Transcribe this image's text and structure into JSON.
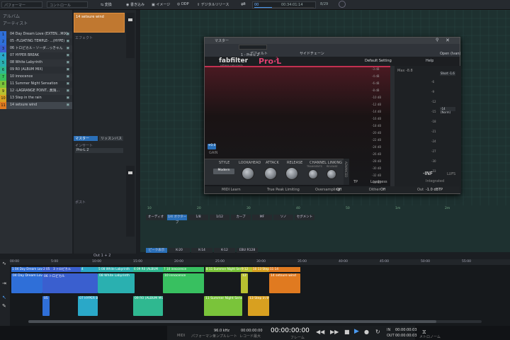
{
  "topbar": {
    "field1": "パフォーマー",
    "field2": "コントロール",
    "btn_change": "変換",
    "btn_write": "書き込み",
    "btn_image": "イメージ",
    "btn_ddp": "DDP",
    "btn_digital": "デジタルリリース",
    "time_start": "00",
    "time_current": "00:34:01:14",
    "time_end": "8/29"
  },
  "leftpanel": {
    "header_album": "アルバム",
    "header_artist": "アーティスト",
    "tracks": [
      {
        "num": "1",
        "label": "04 Day Dream Love (EXTEN...MIX)",
        "color": "#2f6fd8"
      },
      {
        "num": "2",
        "label": "05 -FLOATING TEMPLE- ...(HYPE)",
        "color": "#2f6fd8"
      },
      {
        "num": "3",
        "label": "06 トロピカル・ソーダ...っきゃん",
        "color": "#3a5fcf"
      },
      {
        "num": "4",
        "label": "07 HYPER BREAK",
        "color": "#2aa8c8"
      },
      {
        "num": "5",
        "label": "08 White Labyrinth",
        "color": "#2ab0b0"
      },
      {
        "num": "6",
        "label": "09 R0 (ALBUM MIX)",
        "color": "#2fb890"
      },
      {
        "num": "7",
        "label": "10 innocence",
        "color": "#38c060"
      },
      {
        "num": "8",
        "label": "11 Summer Night Sensation",
        "color": "#7ac43a"
      },
      {
        "num": "9",
        "label": "12 -LAGRANGE POINT...無限...",
        "color": "#b8c030"
      },
      {
        "num": "10",
        "label": "13 Step in the rain",
        "color": "#d8a020"
      },
      {
        "num": "11",
        "label": "14 setsure wind",
        "color": "#e07a20"
      }
    ]
  },
  "midpanel": {
    "track_selected": "14 setsure wind",
    "insert_label": "インサート",
    "fx_label": "エフェクト",
    "plugin_slot": "Pro-L 2",
    "tab_master": "マスター",
    "tab_sub": "リッスンバス",
    "post_label": "ポスト",
    "bottom_label": "Out 1 + 2"
  },
  "editor": {
    "ruler": [
      "10",
      "20",
      "30",
      "40",
      "50",
      "1m",
      "2m"
    ],
    "tabs": [
      "オーディオ",
      "1/4 オクターブ",
      "1/8",
      "1/12",
      "カーブ",
      "MF",
      "ソノ",
      "セグメント"
    ],
    "bottom_tabs": [
      "ピーク表示",
      "K-20",
      "K-14",
      "K-12",
      "EBU R128"
    ]
  },
  "plugin": {
    "title": "マスター",
    "slot": "1 - Pro-L 2",
    "preset": "デフォルト",
    "side": "サイドチェーン",
    "brand": "fabfilter",
    "brand_sub": "software instruments",
    "product": "Pro·L",
    "product_ver": "2",
    "preset_name": "Default Setting",
    "help": "Help",
    "open": "Open (Ivan)",
    "style_label": "STYLE",
    "style_value": "Modern",
    "lookahead_label": "LOOKAHEAD",
    "attack_label": "ATTACK",
    "release_label": "RELEASE",
    "channel_label": "CHANNEL LINKING",
    "transients": "TRANSIENTS",
    "release_sub": "RELEASE",
    "advanced": "ADVANCED",
    "gain_label": "GAIN",
    "gain_value": "+0.0",
    "midi_learn": "MIDI Learn",
    "true_peak": "True Peak Limiting",
    "oversampling_label": "Oversampling",
    "oversampling_value": "Off",
    "dither_label": "Dither",
    "dither_value": "Off",
    "out_label": "Out",
    "out_value": "-1.0 dBTP",
    "tp_label": "TP",
    "loudness_label": "Loudness",
    "inf": "-INF",
    "lufs": "LUFS",
    "integrated": "Integrated",
    "short_term": "Short -1.6",
    "lufs_val": "-14 (Norm)",
    "max_label": "Max -8.8",
    "db_scale": [
      "-3 dB",
      "-4 dB",
      "-6 dB",
      "-8 dB",
      "-10 dB",
      "-12 dB",
      "-14 dB",
      "-16 dB",
      "-18 dB",
      "-20 dB",
      "-22 dB",
      "-24 dB",
      "-26 dB",
      "-28 dB",
      "-30 dB",
      "-32 dB",
      "-34 dB"
    ],
    "lufs_scale": [
      "-6",
      "-9",
      "-12",
      "-15",
      "-18",
      "-21",
      "-24",
      "-27",
      "-30",
      "-33"
    ]
  },
  "arrange": {
    "ruler": [
      "00:00",
      "5:00",
      "10:00",
      "15:00",
      "20:00",
      "25:00",
      "30:00",
      "35:00",
      "40:00",
      "45:00",
      "50:00",
      "55:00"
    ],
    "markers": [
      {
        "label": "1 04 Day Dream Lov",
        "color": "#2f6fd8"
      },
      {
        "label": "2 05",
        "color": "#3a5fcf"
      },
      {
        "label": "3 トロピカル",
        "color": "#3a5fcf"
      },
      {
        "label": "4 ",
        "color": "#2aa8c8"
      },
      {
        "label": "5 08 White Labyrinth",
        "color": "#2ab0b0"
      },
      {
        "label": "6 09 R0 (ALBUM",
        "color": "#2fb890"
      },
      {
        "label": "7 10 innocence",
        "color": "#38c060"
      },
      {
        "label": "8 11 Summer Night Sens",
        "color": "#7ac43a"
      },
      {
        "label": "9 12",
        "color": "#b8c030"
      },
      {
        "label": "10 13 Step in",
        "color": "#d8a020"
      },
      {
        "label": "11 14",
        "color": "#e07a20"
      }
    ],
    "clips": [
      {
        "label": "04 Day Dream Love (E",
        "color": "#2f6fd8"
      },
      {
        "label": "06 トロピカル",
        "color": "#3a5fcf"
      },
      {
        "label": "08 White Labyrinth",
        "color": "#2ab0b0"
      },
      {
        "label": "10 innocence",
        "color": "#38c060"
      },
      {
        "label": "12",
        "color": "#b8c030"
      },
      {
        "label": "14 setsure wind",
        "color": "#e07a20"
      },
      {
        "label": "05",
        "color": "#2f6fd8"
      },
      {
        "label": "07 HYPER B",
        "color": "#2aa8c8"
      },
      {
        "label": "09 R0 (ALBUM MIX)",
        "color": "#2fb890"
      },
      {
        "label": "11 Summer Night Sensat",
        "color": "#7ac43a"
      },
      {
        "label": "13 Step in the",
        "color": "#d8a020"
      }
    ]
  },
  "transport": {
    "midi": "MIDI",
    "perf": "パフォーマンス",
    "rate": "96.0 kHz",
    "rate_sub": "サンプルレート",
    "rec": "00:00:00:00",
    "rec_sub": "レコード最大",
    "time": "00:00:00:00",
    "time_sub": "フレーム",
    "pos1": "00:00:00:03",
    "pos2": "00:00:00:03",
    "in_label": "IN",
    "out_label": "OUT",
    "metronome": "メトロノーム"
  }
}
